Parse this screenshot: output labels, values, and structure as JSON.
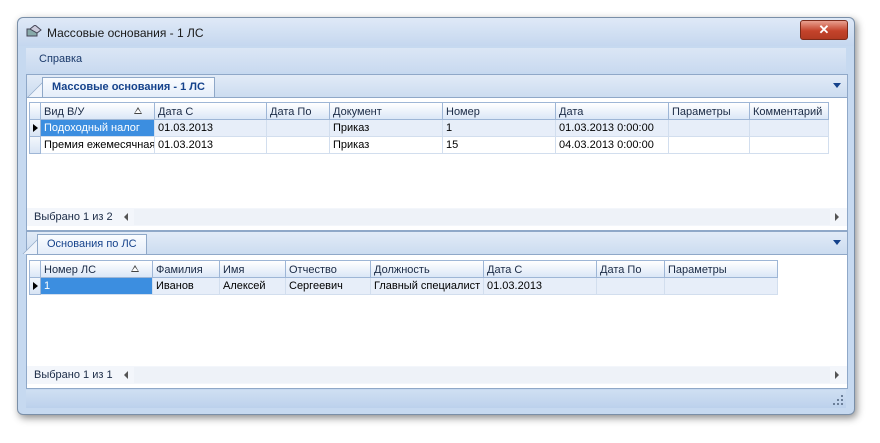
{
  "window": {
    "title": "Массовые основания - 1 ЛС",
    "close_glyph": "✕"
  },
  "menu": {
    "items": [
      "Справка"
    ]
  },
  "top_panel": {
    "tab_label": "Массовые основания - 1 ЛС",
    "columns": [
      "Вид В/У",
      "Дата С",
      "Дата По",
      "Документ",
      "Номер",
      "Дата",
      "Параметры",
      "Комментарий"
    ],
    "rows": [
      [
        "Подоходный налог",
        "01.03.2013",
        "",
        "Приказ",
        "1",
        "01.03.2013 0:00:00",
        "",
        ""
      ],
      [
        "Премия ежемесячная",
        "01.03.2013",
        "",
        "Приказ",
        "15",
        "04.03.2013 0:00:00",
        "",
        ""
      ]
    ],
    "status": "Выбрано 1 из 2"
  },
  "bottom_panel": {
    "tab_label": "Основания по ЛС",
    "columns": [
      "Номер ЛС",
      "Фамилия",
      "Имя",
      "Отчество",
      "Должность",
      "Дата С",
      "Дата По",
      "Параметры"
    ],
    "rows": [
      [
        "1",
        "Иванов",
        "Алексей",
        "Сергеевич",
        "Главный специалист",
        "01.03.2013",
        "",
        ""
      ]
    ],
    "status": "Выбрано 1 из 1"
  },
  "colors": {
    "selection": "#3c8ee0",
    "accent": "#15428b",
    "alt_row": "#e7eef9"
  },
  "icons": [
    "app-icon",
    "close-icon",
    "dropdown-arrow-icon",
    "sort-ascending-icon",
    "row-pointer-icon",
    "scroll-left-icon",
    "scroll-right-icon",
    "size-grip-icon"
  ]
}
